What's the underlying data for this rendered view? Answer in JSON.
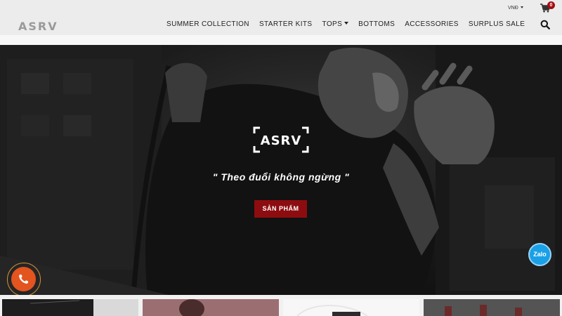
{
  "header": {
    "logo": "ASRV",
    "currency": "VNĐ",
    "cart_count": "0",
    "nav": [
      {
        "label": "SUMMER COLLECTION",
        "has_dropdown": false
      },
      {
        "label": "STARTER KITS",
        "has_dropdown": false
      },
      {
        "label": "TOPS",
        "has_dropdown": true
      },
      {
        "label": "BOTTOMS",
        "has_dropdown": false
      },
      {
        "label": "ACCESSORIES",
        "has_dropdown": false
      },
      {
        "label": "SURPLUS SALE",
        "has_dropdown": false
      }
    ]
  },
  "hero": {
    "brand": "ASRV",
    "tagline": "\" Theo đuổi không ngừng \"",
    "cta_label": "SẢN PHẨM"
  },
  "floating": {
    "zalo_label": "Zalo"
  },
  "icons": [
    "caret-down-icon",
    "cart-icon",
    "search-icon",
    "phone-icon"
  ],
  "colors": {
    "accent": "#8d0c10",
    "badge": "#a30e12",
    "phone": "#e3541f",
    "zalo": "#1aa0e6"
  }
}
